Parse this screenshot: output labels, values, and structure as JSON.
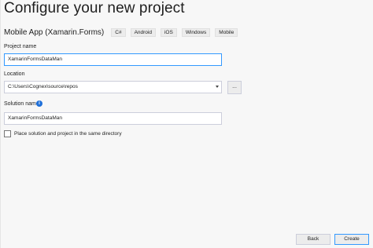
{
  "header": {
    "title": "Configure your new project",
    "template_name": "Mobile App (Xamarin.Forms)",
    "tags": [
      "C#",
      "Android",
      "iOS",
      "Windows",
      "Mobile"
    ]
  },
  "form": {
    "project_name": {
      "label": "Project name",
      "value": "XamarinFormsDataMan"
    },
    "location": {
      "label": "Location",
      "value": "C:\\Users\\Cognex\\source\\repos",
      "browse_label": "..."
    },
    "solution_name": {
      "label": "Solution name",
      "value": "XamarinFormsDataMan",
      "info_icon": "info-icon"
    },
    "same_directory": {
      "label": "Place solution and project in the same directory",
      "checked": false
    }
  },
  "footer": {
    "back_label": "Back",
    "create_label": "Create"
  },
  "colors": {
    "accent": "#3399ff",
    "info": "#1e6fd9"
  }
}
